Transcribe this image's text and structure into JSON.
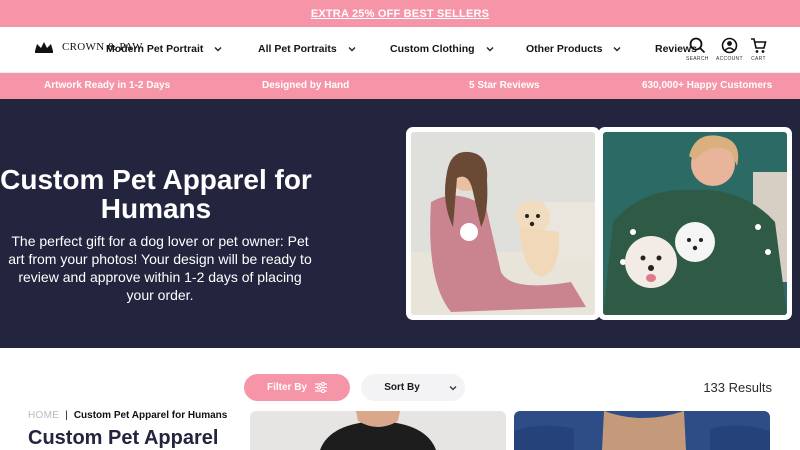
{
  "promo": {
    "text": "EXTRA 25% OFF BEST SELLERS"
  },
  "header": {
    "logo_text": "CROWN & PAW",
    "nav": [
      {
        "label": "Modern Pet Portrait"
      },
      {
        "label": "All Pet Portraits"
      },
      {
        "label": "Custom Clothing"
      },
      {
        "label": "Other Products"
      },
      {
        "label": "Reviews"
      }
    ],
    "icons": {
      "search_label": "SEARCH",
      "account_label": "ACCOUNT",
      "cart_label": "CART"
    }
  },
  "trust_bar": [
    "Artwork Ready in 1-2 Days",
    "Designed by Hand",
    "5 Star Reviews",
    "630,000+ Happy Customers"
  ],
  "hero": {
    "title": "Custom Pet Apparel for Humans",
    "description": "The perfect gift for a dog lover or pet owner: Pet art from your photos! Your design will be ready to review and approve within 1-2 days of placing your order."
  },
  "filters": {
    "filter_label": "Filter By",
    "sort_label": "Sort By"
  },
  "results": {
    "count": "133",
    "label": "Results"
  },
  "breadcrumb": {
    "home": "HOME",
    "separator": "|",
    "current": "Custom Pet Apparel for Humans"
  },
  "page_heading": "Custom Pet Apparel",
  "colors": {
    "pink": "#f694a8",
    "navy": "#23253f"
  }
}
